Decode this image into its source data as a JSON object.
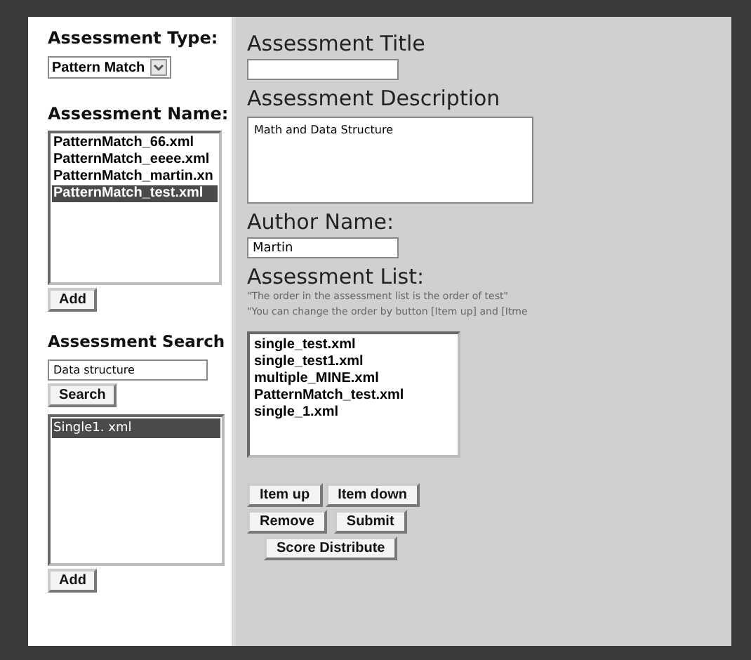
{
  "assessment_type": {
    "label": "Assessment Type:",
    "value": "Pattern Match"
  },
  "assessment_name": {
    "label": "Assessment Name:",
    "items": [
      {
        "text": "PatternMatch_66.xml",
        "selected": false
      },
      {
        "text": "PatternMatch_eeee.xml",
        "selected": false
      },
      {
        "text": "PatternMatch_martin.xn",
        "selected": false
      },
      {
        "text": "PatternMatch_test.xml",
        "selected": true
      }
    ],
    "button": "Add"
  },
  "assessment_search": {
    "label": "Assessment Search",
    "value": "Data structure",
    "search_button": "Search",
    "items": [
      {
        "text": "Single1. xml",
        "selected": true
      }
    ],
    "button": "Add"
  },
  "title": {
    "label": "Assessment Title"
  },
  "description": {
    "label": "Assessment Description",
    "value": "Math and Data Structure"
  },
  "author": {
    "label": "Author Name:",
    "value": "Martin"
  },
  "assessment_list": {
    "label": "Assessment List:",
    "notes": [
      "\"The order in the assessment list is the order of test\"",
      "\"You can change the order by button [Item up] and [Itme"
    ],
    "items": [
      {
        "text": "single_test.xml",
        "selected": false
      },
      {
        "text": "single_test1.xml",
        "selected": false
      },
      {
        "text": "multiple_MINE.xml",
        "selected": false
      },
      {
        "text": "PatternMatch_test.xml",
        "selected": false
      },
      {
        "text": "single_1.xml",
        "selected": false
      }
    ]
  },
  "buttons": [
    [
      "Item up",
      "Item down"
    ],
    [
      "Remove",
      "Submit"
    ],
    [
      "Score Distribute"
    ]
  ]
}
